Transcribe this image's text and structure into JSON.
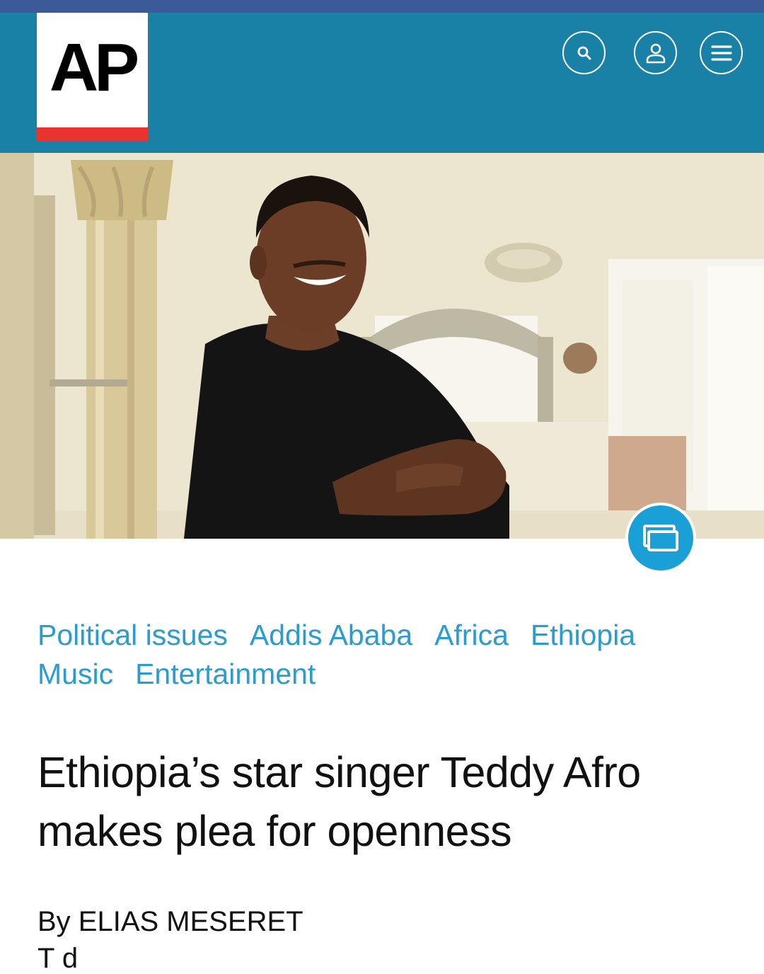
{
  "header": {
    "logo_text": "AP",
    "brand_colors": {
      "header_bg": "#1a81a6",
      "top_strip": "#3c5a99",
      "logo_bar": "#e8332e"
    },
    "buttons": [
      {
        "icon": "search-icon"
      },
      {
        "icon": "user-icon"
      },
      {
        "icon": "menu-icon"
      }
    ]
  },
  "hero": {
    "gallery_icon": "gallery-icon",
    "accent": "#1aa0d6"
  },
  "tags": [
    "Political issues",
    "Addis Ababa",
    "Africa",
    "Ethiopia",
    "Music",
    "Entertainment"
  ],
  "article": {
    "headline": "Ethiopia’s star singer Teddy Afro makes plea for openness",
    "byline": "By ELIAS MESERET",
    "next_line": "T d"
  }
}
